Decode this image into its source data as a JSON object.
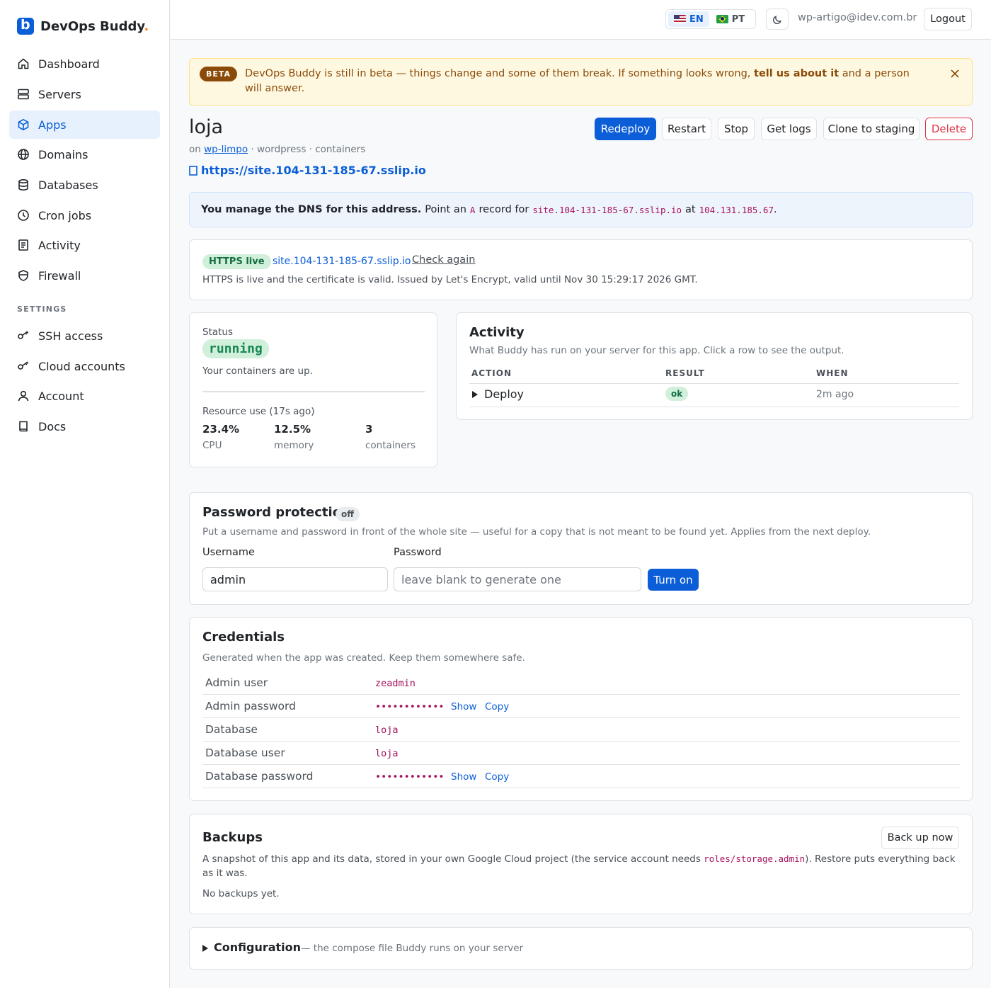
{
  "brand": {
    "name": "DevOps Buddy",
    "dot": "."
  },
  "nav": [
    {
      "label": "Dashboard",
      "icon": "home-icon"
    },
    {
      "label": "Servers",
      "icon": "server-icon"
    },
    {
      "label": "Apps",
      "icon": "cube-icon",
      "active": true
    },
    {
      "label": "Domains",
      "icon": "globe-icon"
    },
    {
      "label": "Databases",
      "icon": "database-icon"
    },
    {
      "label": "Cron jobs",
      "icon": "clock-icon"
    },
    {
      "label": "Activity",
      "icon": "list-icon"
    },
    {
      "label": "Firewall",
      "icon": "shield-icon"
    }
  ],
  "settings": {
    "label": "SETTINGS",
    "items": [
      {
        "label": "SSH access",
        "icon": "key-icon"
      },
      {
        "label": "Cloud accounts",
        "icon": "key-icon"
      },
      {
        "label": "Account",
        "icon": "user-icon"
      },
      {
        "label": "Docs",
        "icon": "book-icon"
      }
    ]
  },
  "topbar": {
    "lang_en": "EN",
    "lang_pt": "PT",
    "email": "wp-artigo@idev.com.br",
    "logout": "Logout"
  },
  "beta": {
    "badge": "BETA",
    "text_before": "DevOps Buddy is still in beta — things change and some of them break. If something looks wrong,",
    "link": "tell us about it",
    "text_after": "and a person will answer."
  },
  "app": {
    "name": "loja",
    "meta_on": "on",
    "server": "wp-limpo",
    "meta_rest": "· wordpress · containers",
    "url": "https://site.104-131-185-67.sslip.io"
  },
  "actions": {
    "redeploy": "Redeploy",
    "restart": "Restart",
    "stop": "Stop",
    "logs": "Get logs",
    "clone": "Clone to staging",
    "delete": "Delete"
  },
  "dns": {
    "bold": "You manage the DNS for this address.",
    "t1": "Point an",
    "record": "A",
    "t2": "record for",
    "host": "site.104-131-185-67.sslip.io",
    "t3": "at",
    "ip": "104.131.185.67",
    "t4": "."
  },
  "https": {
    "badge": "HTTPS live",
    "host": "site.104-131-185-67.sslip.io",
    "check": "Check again",
    "desc": "HTTPS is live and the certificate is valid. Issued by Let's Encrypt, valid until Nov 30 15:29:17 2026 GMT."
  },
  "status": {
    "label": "Status",
    "value": "running",
    "desc": "Your containers are up.",
    "resource_label": "Resource use (17s ago)",
    "cpu": "23.4%",
    "cpu_label": "CPU",
    "memory": "12.5%",
    "memory_label": "memory",
    "containers": "3",
    "containers_label": "containers"
  },
  "activity": {
    "title": "Activity",
    "subtitle": "What Buddy has run on your server for this app. Click a row to see the output.",
    "headers": [
      "ACTION",
      "RESULT",
      "WHEN"
    ],
    "rows": [
      {
        "action": "Deploy",
        "result": "ok",
        "when": "2m ago"
      }
    ]
  },
  "password": {
    "title": "Password protection",
    "state": "off",
    "desc": "Put a username and password in front of the whole site — useful for a copy that is not meant to be found yet. Applies from the next deploy.",
    "username_label": "Username",
    "username_value": "admin",
    "password_label": "Password",
    "password_placeholder": "leave blank to generate one",
    "submit": "Turn on"
  },
  "credentials": {
    "title": "Credentials",
    "subtitle": "Generated when the app was created. Keep them somewhere safe.",
    "show": "Show",
    "copy": "Copy",
    "rows": [
      {
        "key": "Admin user",
        "value": "zeadmin"
      },
      {
        "key": "Admin password",
        "value": "••••••••••••",
        "secret": true
      },
      {
        "key": "Database",
        "value": "loja"
      },
      {
        "key": "Database user",
        "value": "loja"
      },
      {
        "key": "Database password",
        "value": "••••••••••••",
        "secret": true
      }
    ]
  },
  "backups": {
    "title": "Backups",
    "desc_before": "A snapshot of this app and its data, stored in your own Google Cloud project (the service account needs",
    "role": "roles/storage.admin",
    "desc_after": "). Restore puts everything back as it was.",
    "empty": "No backups yet.",
    "button": "Back up now"
  },
  "config": {
    "title": "Configuration",
    "subtitle": "— the compose file Buddy runs on your server"
  }
}
